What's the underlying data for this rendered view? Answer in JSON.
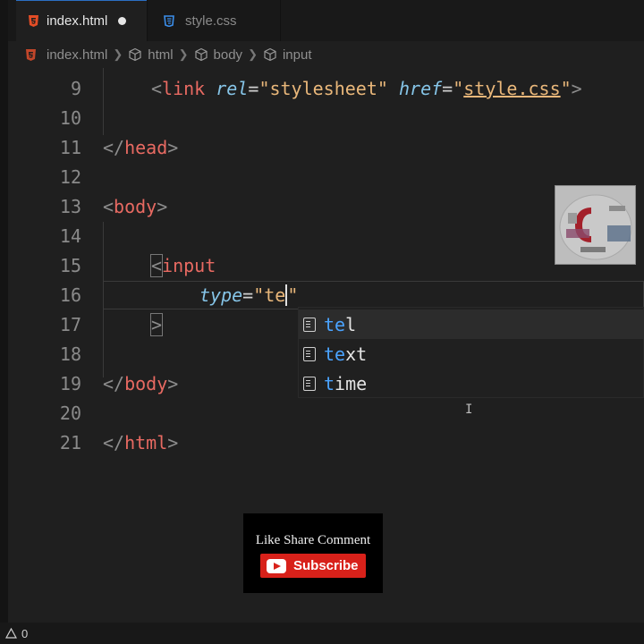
{
  "tabs": [
    {
      "label": "index.html",
      "icon": "html5-icon",
      "active": true,
      "unsaved": true
    },
    {
      "label": "style.css",
      "icon": "css-icon",
      "active": false
    }
  ],
  "breadcrumb": {
    "file": "index.html",
    "items": [
      "html",
      "body",
      "input"
    ]
  },
  "editor": {
    "line_numbers": [
      "9",
      "10",
      "11",
      "12",
      "13",
      "14",
      "15",
      "16",
      "17",
      "18",
      "19",
      "20",
      "21"
    ],
    "line9": {
      "open": "<",
      "tag": "link",
      "attr1": "rel",
      "eq1": "=",
      "val1": "\"stylesheet\"",
      "attr2": "href",
      "eq2": "=",
      "q_open": "\"",
      "val2": "style.css",
      "q_close": "\"",
      "close": ">"
    },
    "line11": {
      "open": "</",
      "tag": "head",
      "close": ">"
    },
    "line13": {
      "open": "<",
      "tag": "body",
      "close": ">"
    },
    "line15": {
      "open": "<",
      "tag": "input"
    },
    "line16": {
      "attr": "type",
      "eq": "=",
      "q_open": "\"",
      "typed": "te",
      "q_close": "\""
    },
    "line17": {
      "close": ">"
    },
    "line19": {
      "open": "</",
      "tag": "body",
      "close": ">"
    },
    "line21": {
      "open": "</",
      "tag": "html",
      "close": ">"
    }
  },
  "suggestions": [
    {
      "match": "te",
      "rest": "l",
      "selected": true
    },
    {
      "match": "te",
      "rest": "xt",
      "selected": false
    },
    {
      "match": "t",
      "rest": "ime",
      "selected": false
    }
  ],
  "overlay": {
    "like_text": "Like Share Comment",
    "subscribe_label": "Subscribe"
  },
  "statusbar": {
    "count": "0"
  },
  "colors": {
    "background": "#1f1f1f",
    "tag_name": "#e86a62",
    "attribute": "#86c5e8",
    "string": "#e9b77a",
    "accent_blue": "#4aa3ff",
    "subscribe_red": "#d8211a"
  }
}
